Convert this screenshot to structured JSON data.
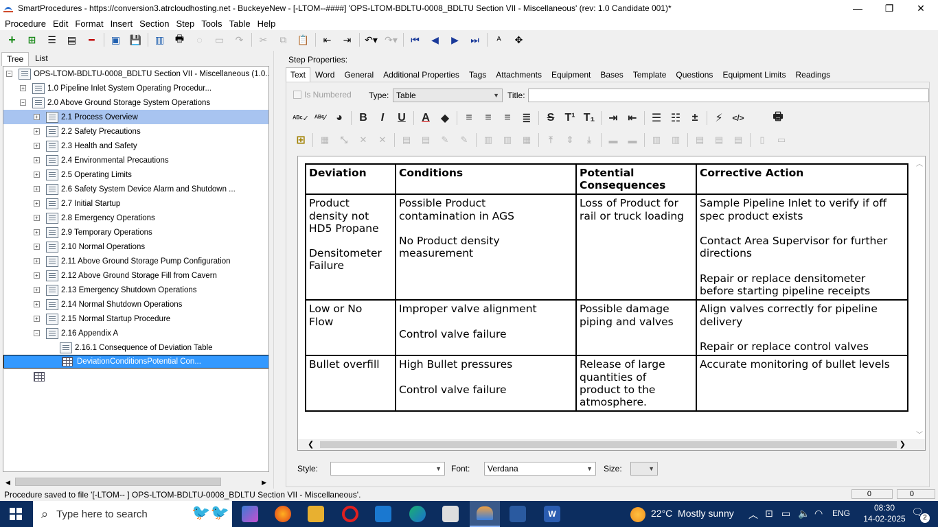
{
  "window": {
    "title": "SmartProcedures - https://conversion3.atrcloudhosting.net - BuckeyeNew - [-LTOM--####] 'OPS-LTOM-BDLTU-0008_BDLTU Section VII - Miscellaneous' (rev: 1.0 Candidate 001)*",
    "minimize": "—",
    "restore": "❐",
    "close": "✕"
  },
  "menu": [
    "Procedure",
    "Edit",
    "Format",
    "Insert",
    "Section",
    "Step",
    "Tools",
    "Table",
    "Help"
  ],
  "left_tabs": [
    "Tree",
    "List"
  ],
  "tree": {
    "root": "OPS-LTOM-BDLTU-0008_BDLTU Section VII - Miscellaneous (1.0...",
    "items": [
      "1.0 Pipeline Inlet System Operating Procedur...",
      "2.0 Above Ground Storage System Operations",
      "2.1 Process Overview",
      "2.2 Safety Precautions",
      "2.3 Health and Safety",
      "2.4 Environmental Precautions",
      "2.5 Operating Limits",
      "2.6 Safety System Device Alarm and Shutdown ...",
      "2.7 Initial Startup",
      "2.8 Emergency Operations",
      "2.9 Temporary Operations",
      "2.10 Normal Operations",
      "2.11 Above Ground Storage Pump Configuration",
      "2.12 Above Ground Storage Fill from Cavern",
      "2.13 Emergency Shutdown Operations",
      "2.14 Normal Shutdown Operations",
      "2.15 Normal Startup Procedure",
      "2.16 Appendix A",
      "2.16.1 Consequence of Deviation Table",
      "DeviationConditionsPotential Con..."
    ]
  },
  "step_properties": {
    "header": "Step Properties:",
    "tabs": [
      "Text",
      "Word",
      "General",
      "Additional Properties",
      "Tags",
      "Attachments",
      "Equipment",
      "Bases",
      "Template",
      "Questions",
      "Equipment Limits",
      "Readings"
    ],
    "is_numbered": "Is Numbered",
    "type_label": "Type:",
    "type_value": "Table",
    "title_label": "Title:"
  },
  "table": {
    "headers": [
      "Deviation",
      "Conditions",
      "Potential\nConsequences",
      "Corrective Action"
    ],
    "rows": [
      [
        "Product\ndensity not\nHD5 Propane\n\nDensitometer\nFailure",
        "Possible Product\ncontamination in AGS\n\nNo Product density\nmeasurement",
        "Loss of Product for\nrail or truck loading",
        "Sample Pipeline Inlet to verify if off\nspec product exists\n\nContact Area Supervisor for further\ndirections\n\nRepair or replace densitometer\nbefore starting pipeline receipts"
      ],
      [
        "Low or No\nFlow",
        "Improper valve alignment\n\nControl valve failure",
        "Possible damage\npiping and valves",
        "Align valves correctly for pipeline\ndelivery\n\nRepair or replace control valves"
      ],
      [
        "Bullet overfill",
        "High Bullet pressures\n\nControl valve failure",
        "Release of large\nquantities of\nproduct to the\natmosphere.",
        "Accurate monitoring of bullet levels"
      ]
    ]
  },
  "bottom": {
    "style_label": "Style:",
    "style_value": "",
    "font_label": "Font:",
    "font_value": "Verdana",
    "size_label": "Size:",
    "size_value": ""
  },
  "status": {
    "message": "Procedure saved to file '[-LTOM--     ] OPS-LTOM-BDLTU-0008_BDLTU Section VII - Miscellaneous'.",
    "count1": "0",
    "count2": "0"
  },
  "taskbar": {
    "search_placeholder": "Type here to search",
    "weather": "22°C  Mostly sunny",
    "lang": "ENG",
    "time": "08:30",
    "date": "14-02-2025",
    "notif": "2"
  }
}
